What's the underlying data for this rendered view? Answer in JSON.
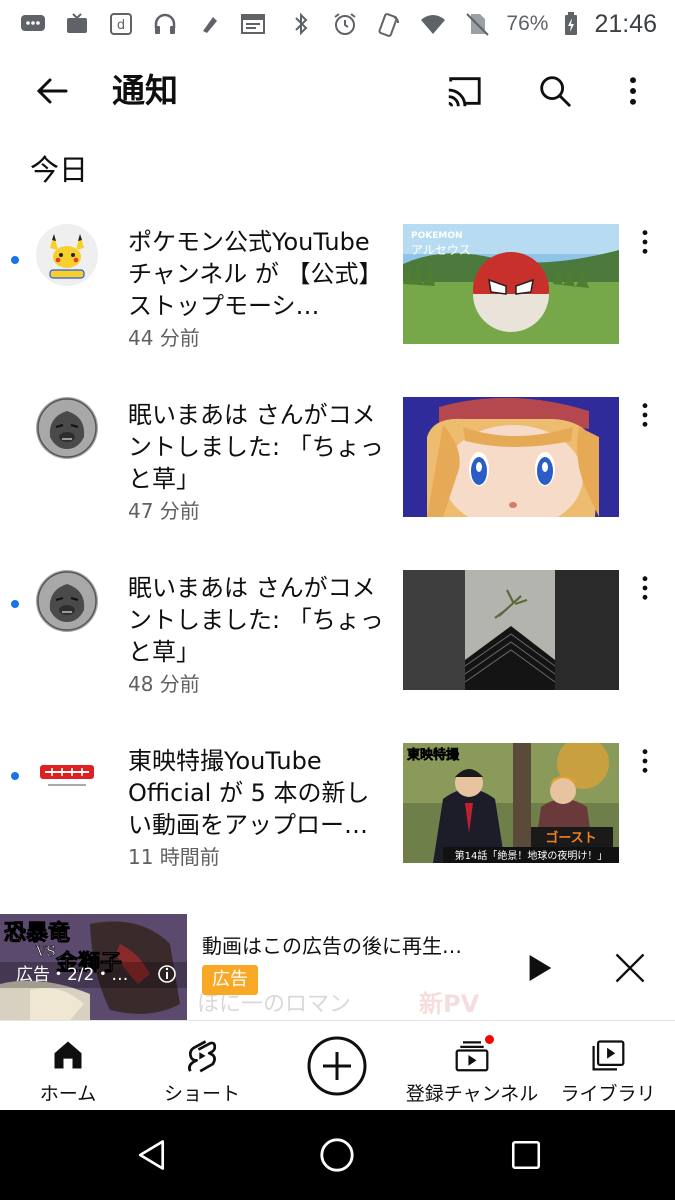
{
  "status_bar": {
    "battery": "76%",
    "time": "21:46"
  },
  "app_bar": {
    "title": "通知"
  },
  "section": {
    "today": "今日"
  },
  "notifications": [
    {
      "text": "ポケモン公式YouTubeチャンネル が 【公式】ストップモーシ…",
      "time": "44 分前",
      "unread": true
    },
    {
      "text": "眠いまあは さんがコメントしました: 「ちょっと草」",
      "time": "47 分前",
      "unread": false
    },
    {
      "text": "眠いまあは さんがコメントしました: 「ちょっと草」",
      "time": "48 分前",
      "unread": true
    },
    {
      "text": "東映特撮YouTube Official が 5 本の新しい動画をアップロー…",
      "time": "11 時間前",
      "unread": true
    }
  ],
  "thumb_texts": {
    "pokemon_logo": "POKEMON",
    "arceus": "アルセウス",
    "toei_logo": "東映特撮",
    "episode": "第14話「絶景！地球の夜明け！」",
    "ghost": "ゴースト"
  },
  "mini_player": {
    "title": "動画はこの広告の後に再生…",
    "badge": "広告",
    "thumb_line1": "恐暴竜",
    "thumb_line2": "VS",
    "thumb_line3": "金獅子",
    "thumb_ad": "広告・2/2・…",
    "peek_text": "ほに一のロマン",
    "peek_right": "新PV"
  },
  "bottom_nav": {
    "home": "ホーム",
    "shorts": "ショート",
    "subscriptions": "登録チャンネル",
    "library": "ライブラリ"
  },
  "colors": {
    "unread_dot": "#1a73e8",
    "ad_badge": "#f9a825",
    "notification_dot": "#ff0000"
  }
}
